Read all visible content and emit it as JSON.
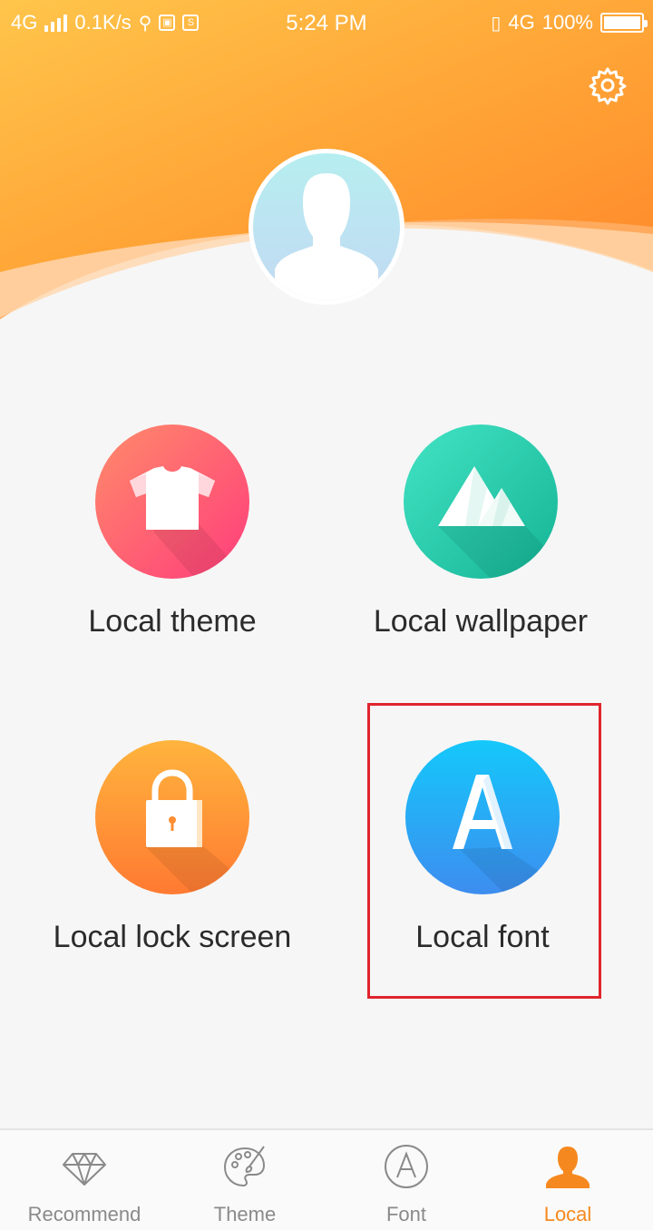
{
  "status_bar": {
    "network_left": "4G",
    "speed": "0.1K/s",
    "time": "5:24 PM",
    "network_right": "4G",
    "battery": "100%"
  },
  "tiles": [
    {
      "label": "Local theme",
      "icon": "shirt-icon"
    },
    {
      "label": "Local wallpaper",
      "icon": "mountain-icon"
    },
    {
      "label": "Local lock screen",
      "icon": "padlock-icon"
    },
    {
      "label": "Local font",
      "icon": "font-a-icon"
    }
  ],
  "tabs": [
    {
      "label": "Recommend",
      "icon": "diamond-icon",
      "active": false
    },
    {
      "label": "Theme",
      "icon": "palette-icon",
      "active": false
    },
    {
      "label": "Font",
      "icon": "font-circle-icon",
      "active": false
    },
    {
      "label": "Local",
      "icon": "person-icon",
      "active": true
    }
  ],
  "colors": {
    "header_orange": "#ff9b2f",
    "active_tab": "#f5891f",
    "highlight_box": "#e0252e"
  }
}
